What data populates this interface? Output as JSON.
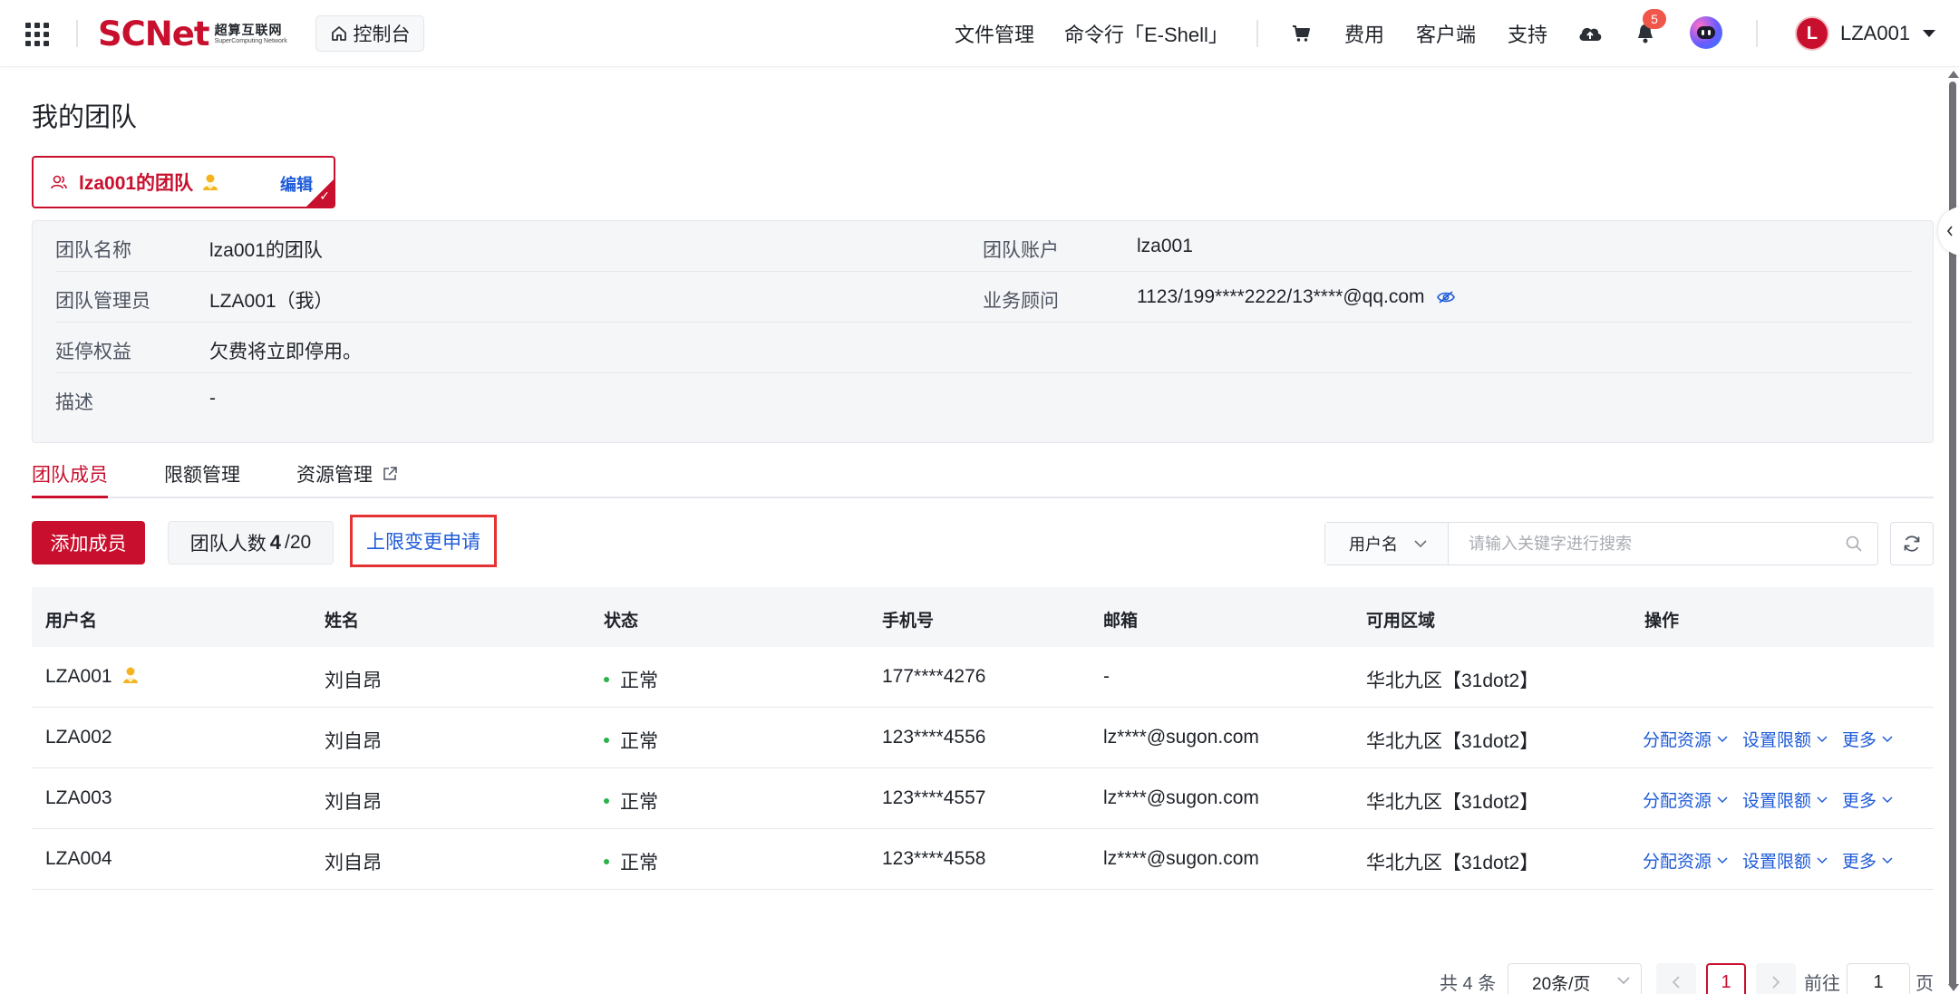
{
  "brand": {
    "logo_text": "SCNet",
    "logo_cn": "超算互联网",
    "logo_en": "SuperComputing Network",
    "accent": "#c8102e"
  },
  "topbar": {
    "console_label": "控制台",
    "nav": {
      "file_manage": "文件管理",
      "eshell": "命令行「E-Shell」",
      "cost": "费用",
      "client": "客户端",
      "support": "支持"
    },
    "notification_count": "5",
    "user_initial": "L",
    "user_name": "LZA001"
  },
  "page": {
    "title": "我的团队"
  },
  "team_card": {
    "name": "lza001的团队",
    "edit_label": "编辑"
  },
  "info": {
    "team_name_label": "团队名称",
    "team_name_value": "lza001的团队",
    "team_account_label": "团队账户",
    "team_account_value": "lza001",
    "team_admin_label": "团队管理员",
    "team_admin_value": "LZA001（我）",
    "advisor_label": "业务顾问",
    "advisor_value": "1123/199****2222/13****@qq.com",
    "grace_label": "延停权益",
    "grace_value": "欠费将立即停用。",
    "desc_label": "描述",
    "desc_value": "-"
  },
  "tabs": {
    "members": "团队成员",
    "quota": "限额管理",
    "resources": "资源管理"
  },
  "toolbar": {
    "add_member": "添加成员",
    "count_prefix": "团队人数",
    "count_current": "4",
    "count_max": "/20",
    "limit_change": "上限变更申请",
    "search_field": "用户名",
    "search_placeholder": "请输入关键字进行搜索"
  },
  "table": {
    "headers": {
      "username": "用户名",
      "name": "姓名",
      "status": "状态",
      "phone": "手机号",
      "email": "邮箱",
      "region": "可用区域",
      "actions": "操作"
    },
    "action_labels": {
      "assign": "分配资源",
      "set_quota": "设置限额",
      "more": "更多"
    },
    "rows": [
      {
        "username": "LZA001",
        "name": "刘自昂",
        "status": "正常",
        "phone": "177****4276",
        "email": "-",
        "region": "华北九区【31dot2】"
      },
      {
        "username": "LZA002",
        "name": "刘自昂",
        "status": "正常",
        "phone": "123****4556",
        "email": "lz****@sugon.com",
        "region": "华北九区【31dot2】"
      },
      {
        "username": "LZA003",
        "name": "刘自昂",
        "status": "正常",
        "phone": "123****4557",
        "email": "lz****@sugon.com",
        "region": "华北九区【31dot2】"
      },
      {
        "username": "LZA004",
        "name": "刘自昂",
        "status": "正常",
        "phone": "123****4558",
        "email": "lz****@sugon.com",
        "region": "华北九区【31dot2】"
      }
    ]
  },
  "pagination": {
    "total": "共 4 条",
    "page_size": "20条/页",
    "current_page": "1",
    "goto_label": "前往",
    "goto_value": "1",
    "page_unit": "页"
  }
}
